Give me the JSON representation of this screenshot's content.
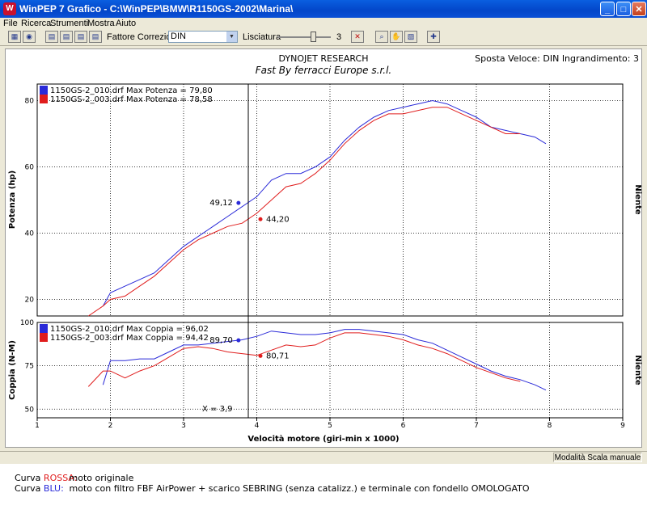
{
  "window": {
    "app_icon": "W",
    "title": "WinPEP 7    Grafico - C:\\WinPEP\\BMW\\R1150GS-2002\\Marina\\",
    "minimize": "_",
    "maximize": "□",
    "close": "✕"
  },
  "menu": [
    "File",
    "Ricerca",
    "Strumenti",
    "Mostra",
    "Aiuto"
  ],
  "toolbar": {
    "correction_label": "Fattore Correzione:",
    "correction_value": "DIN",
    "smoothing_label": "Lisciatura",
    "smoothing_value": "3",
    "icons": [
      "grid-icon",
      "globe-icon",
      "chart-run-1-icon",
      "chart-run-2-icon",
      "chart-run-3-icon",
      "chart-run-4-icon",
      "cancel-run-icon",
      "zoom-icon",
      "hand-icon",
      "chart-options-icon",
      "crosshair-icon"
    ]
  },
  "chart": {
    "header_left": "DYNOJET RESEARCH",
    "header_right": "Sposta Veloce: DIN  Ingrandimento: 3",
    "subtitle": "Fast By ferracci Europe s.r.l.",
    "side_label": "Niente",
    "x_axis_label": "Velocità motore (giri-min x 1000)",
    "cursor_label": "X = 3,9",
    "colors": {
      "blue": "#2a2ad8",
      "red": "#e01c1c",
      "grid": "#000000"
    }
  },
  "chart_data": [
    {
      "type": "line",
      "ylabel": "Potenza (hp)",
      "xlim": [
        1,
        9
      ],
      "ylim": [
        15,
        85
      ],
      "yticks": [
        20,
        40,
        60,
        80
      ],
      "grid": true,
      "legend": "top-left",
      "series": [
        {
          "name": "1150GS-2_010.drf Max Potenza = 79,80",
          "color": "#2a2ad8",
          "x": [
            1.9,
            2.0,
            2.2,
            2.4,
            2.6,
            2.8,
            3.0,
            3.2,
            3.4,
            3.6,
            3.8,
            4.0,
            4.2,
            4.4,
            4.6,
            4.8,
            5.0,
            5.2,
            5.4,
            5.6,
            5.8,
            6.0,
            6.2,
            6.4,
            6.6,
            6.8,
            7.0,
            7.2,
            7.4,
            7.6,
            7.8,
            7.95
          ],
          "y": [
            18,
            22,
            24,
            26,
            28,
            32,
            36,
            39,
            42,
            45,
            48,
            51,
            56,
            58,
            58,
            60,
            63,
            68,
            72,
            75,
            77,
            78,
            79,
            80,
            79,
            77,
            75,
            72,
            71,
            70,
            69,
            67
          ]
        },
        {
          "name": "1150GS-2_003.drf Max Potenza = 78,58",
          "color": "#e01c1c",
          "x": [
            1.7,
            1.9,
            2.0,
            2.2,
            2.4,
            2.6,
            2.8,
            3.0,
            3.2,
            3.4,
            3.6,
            3.8,
            4.0,
            4.2,
            4.4,
            4.6,
            4.8,
            5.0,
            5.2,
            5.4,
            5.6,
            5.8,
            6.0,
            6.2,
            6.4,
            6.6,
            6.8,
            7.0,
            7.2,
            7.4,
            7.6
          ],
          "y": [
            15,
            18,
            20,
            21,
            24,
            27,
            31,
            35,
            38,
            40,
            42,
            43,
            46,
            50,
            54,
            55,
            58,
            62,
            67,
            71,
            74,
            76,
            76,
            77,
            78,
            78,
            76,
            74,
            72,
            70,
            70
          ]
        }
      ],
      "annotations": [
        {
          "label": "49,12",
          "x": 3.75,
          "y": 49.12,
          "series": 0
        },
        {
          "label": "44,20",
          "x": 4.05,
          "y": 44.2,
          "series": 1
        }
      ]
    },
    {
      "type": "line",
      "ylabel": "Coppia (N-M)",
      "xlim": [
        1,
        9
      ],
      "ylim": [
        45,
        100
      ],
      "yticks": [
        50,
        75,
        100
      ],
      "xticks": [
        1,
        2,
        3,
        4,
        5,
        6,
        7,
        8,
        9
      ],
      "grid": true,
      "legend": "top-left",
      "series": [
        {
          "name": "1150GS-2_010.drf Max Coppia = 96,02",
          "color": "#2a2ad8",
          "x": [
            1.9,
            2.0,
            2.2,
            2.4,
            2.6,
            2.8,
            3.0,
            3.2,
            3.4,
            3.6,
            3.8,
            4.0,
            4.2,
            4.4,
            4.6,
            4.8,
            5.0,
            5.2,
            5.4,
            5.6,
            5.8,
            6.0,
            6.2,
            6.4,
            6.6,
            6.8,
            7.0,
            7.2,
            7.4,
            7.6,
            7.8,
            7.95
          ],
          "y": [
            64,
            78,
            78,
            79,
            79,
            83,
            87,
            87,
            88,
            89,
            90,
            92,
            95,
            94,
            93,
            93,
            94,
            96,
            96,
            95,
            94,
            93,
            90,
            88,
            84,
            80,
            76,
            72,
            69,
            67,
            64,
            61
          ]
        },
        {
          "name": "1150GS-2_003.drf Max Coppia = 94,42",
          "color": "#e01c1c",
          "x": [
            1.7,
            1.9,
            2.0,
            2.2,
            2.4,
            2.6,
            2.8,
            3.0,
            3.2,
            3.4,
            3.6,
            3.8,
            4.0,
            4.2,
            4.4,
            4.6,
            4.8,
            5.0,
            5.2,
            5.4,
            5.6,
            5.8,
            6.0,
            6.2,
            6.4,
            6.6,
            6.8,
            7.0,
            7.2,
            7.4,
            7.6
          ],
          "y": [
            63,
            72,
            72,
            68,
            72,
            75,
            80,
            85,
            86,
            85,
            83,
            82,
            81,
            84,
            87,
            86,
            87,
            91,
            94,
            94,
            93,
            92,
            90,
            87,
            85,
            82,
            78,
            74,
            71,
            68,
            66
          ]
        }
      ],
      "annotations": [
        {
          "label": "89,70",
          "x": 3.75,
          "y": 89.7,
          "series": 0
        },
        {
          "label": "80,71",
          "x": 4.05,
          "y": 80.71,
          "series": 1
        }
      ]
    }
  ],
  "status": {
    "right": "Modalità Scala manuale"
  },
  "notes": [
    {
      "tag_prefix": "Curva ",
      "tag_color_word": "ROSSA:",
      "color": "#e01c1c",
      "text": "moto originale"
    },
    {
      "tag_prefix": "Curva ",
      "tag_color_word": "BLU:",
      "color": "#2a2ad8",
      "text": "moto con filtro FBF AirPower + scarico SEBRING (senza catalizz.) e terminale con fondello OMOLOGATO"
    }
  ]
}
